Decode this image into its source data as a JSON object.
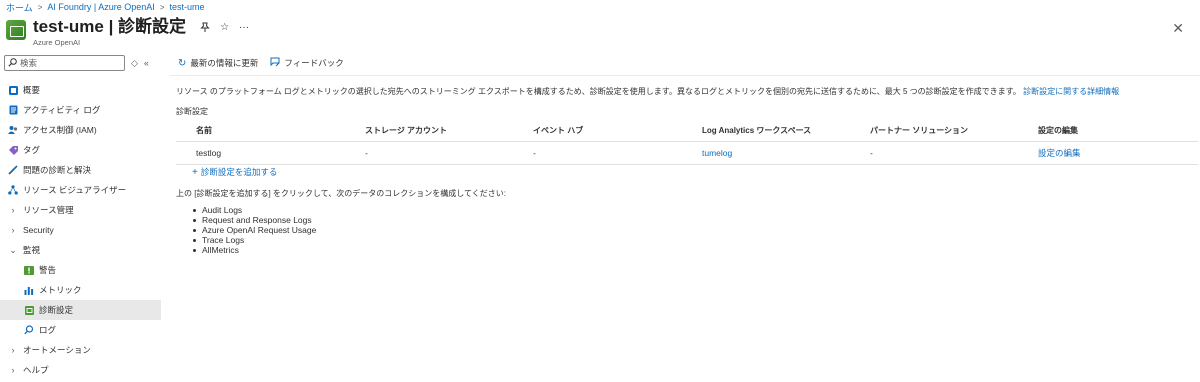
{
  "breadcrumb": [
    "ホーム",
    "AI Foundry | Azure OpenAI",
    "test-ume"
  ],
  "header": {
    "title": "test-ume | 診断設定",
    "subtitle": "Azure OpenAI"
  },
  "sidebar": {
    "search_placeholder": "検索",
    "items": [
      {
        "label": "概要",
        "icon": "overview-icon"
      },
      {
        "label": "アクティビティ ログ",
        "icon": "activity-log-icon"
      },
      {
        "label": "アクセス制御 (IAM)",
        "icon": "iam-icon"
      },
      {
        "label": "タグ",
        "icon": "tag-icon"
      },
      {
        "label": "問題の診断と解決",
        "icon": "wrench-icon"
      },
      {
        "label": "リソース ビジュアライザー",
        "icon": "visualizer-icon"
      },
      {
        "label": "リソース管理",
        "icon": "chevron-right-icon"
      },
      {
        "label": "Security",
        "icon": "chevron-right-icon"
      },
      {
        "label": "監視",
        "icon": "chevron-down-icon"
      },
      {
        "label": "警告",
        "icon": "alert-icon"
      },
      {
        "label": "メトリック",
        "icon": "metrics-icon"
      },
      {
        "label": "診断設定",
        "icon": "diagnostic-settings-icon"
      },
      {
        "label": "ログ",
        "icon": "logs-icon"
      },
      {
        "label": "オートメーション",
        "icon": "chevron-right-icon"
      },
      {
        "label": "ヘルプ",
        "icon": "chevron-right-icon"
      }
    ]
  },
  "toolbar": {
    "refresh_label": "最新の情報に更新",
    "feedback_label": "フィードバック"
  },
  "main": {
    "description": "リソース のプラットフォーム ログとメトリックの選択した宛先へのストリーミング エクスポートを構成するため、診断設定を使用します。異なるログとメトリックを個別の宛先に送信するために、最大 5 つの診断設定を作成できます。",
    "description_link": "診断設定に関する詳細情報",
    "section_label": "診断設定",
    "table": {
      "headers": [
        "名前",
        "ストレージ アカウント",
        "イベント ハブ",
        "Log Analytics ワークスペース",
        "パートナー ソリューション",
        "設定の編集"
      ],
      "rows": [
        [
          "testlog",
          "-",
          "-",
          "tumelog",
          "-",
          "設定の編集"
        ]
      ]
    },
    "add_label": "診断設定を追加する",
    "instructions": "上の [診断設定を追加する] をクリックして、次のデータのコレクションを構成してください:",
    "categories": [
      "Audit Logs",
      "Request and Response Logs",
      "Azure OpenAI Request Usage",
      "Trace Logs",
      "AllMetrics"
    ]
  },
  "colors": {
    "link": "#0f6cbd",
    "active_nav_bg": "#e8e8e8",
    "resource_icon": "#4f9a34"
  }
}
